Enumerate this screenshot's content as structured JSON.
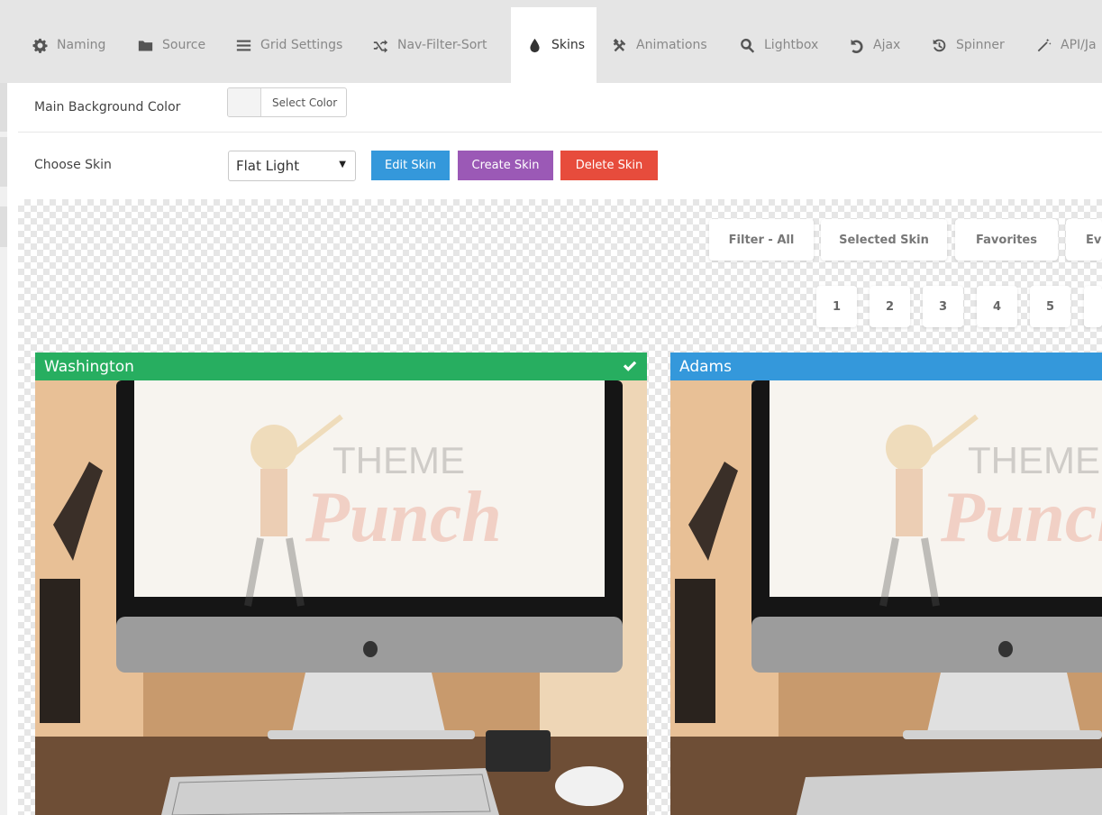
{
  "tabs": [
    {
      "label": "Naming",
      "icon": "gear-icon"
    },
    {
      "label": "Source",
      "icon": "folder-icon"
    },
    {
      "label": "Grid Settings",
      "icon": "list-icon"
    },
    {
      "label": "Nav-Filter-Sort",
      "icon": "shuffle-icon"
    },
    {
      "label": "Skins",
      "icon": "droplet-icon",
      "active": true
    },
    {
      "label": "Animations",
      "icon": "tools-icon"
    },
    {
      "label": "Lightbox",
      "icon": "search-icon"
    },
    {
      "label": "Ajax",
      "icon": "undo-icon"
    },
    {
      "label": "Spinner",
      "icon": "history-icon"
    },
    {
      "label": "API/Ja",
      "icon": "magic-wand-icon"
    }
  ],
  "settings": {
    "bg_color_label": "Main Background Color",
    "select_color_label": "Select Color",
    "choose_skin_label": "Choose Skin",
    "skin_value": "Flat Light",
    "edit_skin": "Edit Skin",
    "create_skin": "Create Skin",
    "delete_skin": "Delete Skin"
  },
  "preview": {
    "filters": [
      "Filter - All",
      "Selected Skin",
      "Favorites",
      "Ev"
    ],
    "pages": [
      "1",
      "2",
      "3",
      "4",
      "5"
    ],
    "cards": [
      {
        "title": "Washington",
        "header_color": "#27ae60",
        "selected": true,
        "watermark_top": "THEME",
        "watermark_bottom": "Punch"
      },
      {
        "title": "Adams",
        "header_color": "#3498db",
        "selected": false,
        "watermark_top": "THEME",
        "watermark_bottom": "Punch"
      }
    ]
  },
  "colors": {
    "edit": "#3498db",
    "create": "#9b59b6",
    "delete": "#e74c3c",
    "selected_card": "#27ae60",
    "card": "#3498db"
  }
}
